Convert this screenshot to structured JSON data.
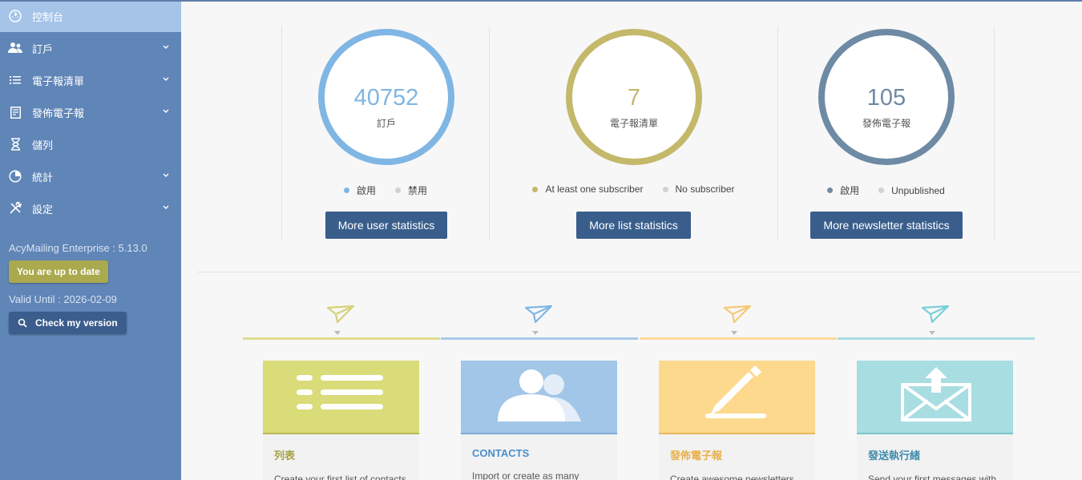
{
  "sidebar": {
    "items": [
      {
        "label": "控制台",
        "icon": "dashboard-icon",
        "active": true
      },
      {
        "label": "訂戶",
        "icon": "users-icon",
        "chevron": true
      },
      {
        "label": "電子報清單",
        "icon": "list-icon",
        "chevron": true
      },
      {
        "label": "發佈電子報",
        "icon": "newsletter-icon",
        "chevron": true
      },
      {
        "label": "儲列",
        "icon": "hourglass-icon"
      },
      {
        "label": "統計",
        "icon": "pie-chart-icon",
        "chevron": true
      },
      {
        "label": "設定",
        "icon": "tools-icon",
        "chevron": true
      }
    ],
    "version": "AcyMailing Enterprise : 5.13.0",
    "uptodate_label": "You are up to date",
    "valid_until": "Valid Until : 2026-02-09",
    "check_version_label": "Check my version"
  },
  "stats": [
    {
      "number": "40752",
      "label": "訂戶",
      "color": "#7fb6e3",
      "legend": [
        {
          "text": "啟用",
          "color": "#7fb6e3"
        },
        {
          "text": "禁用",
          "color": "#d2d2d2"
        }
      ],
      "button": "More user statistics"
    },
    {
      "number": "7",
      "label": "電子報清單",
      "color": "#c4b86a",
      "legend": [
        {
          "text": "At least one subscriber",
          "color": "#c4b86a"
        },
        {
          "text": "No subscriber",
          "color": "#d2d2d2"
        }
      ],
      "button": "More list statistics"
    },
    {
      "number": "105",
      "label": "發佈電子報",
      "color": "#6e8aa4",
      "legend": [
        {
          "text": "啟用",
          "color": "#6e8aa4"
        },
        {
          "text": "Unpublished",
          "color": "#d2d2d2"
        }
      ],
      "button": "More newsletter statistics"
    }
  ],
  "steps": [
    {
      "color": "#dfdc8c",
      "plane_color": "#d8d178"
    },
    {
      "color": "#a8c9e8",
      "plane_color": "#7fb6e3"
    },
    {
      "color": "#fcd99a",
      "plane_color": "#f7c877"
    },
    {
      "color": "#a9dde3",
      "plane_color": "#79cfd9"
    }
  ],
  "cards": [
    {
      "title": "列表",
      "desc": "Create your first list of contacts",
      "color": "#dadb79",
      "title_color": "#a6a144",
      "icon": "list-lines-icon"
    },
    {
      "title": "CONTACTS",
      "desc": "Import or create as many",
      "color": "#a2c6e8",
      "title_color": "#4a8fcb",
      "icon": "contacts-icon"
    },
    {
      "title": "發佈電子報",
      "desc": "Create awesome newsletters",
      "color": "#fdd98e",
      "title_color": "#e8b04a",
      "icon": "pencil-icon"
    },
    {
      "title": "發送執行緒",
      "desc": "Send your first messages with",
      "color": "#a8dde2",
      "title_color": "#3e8cab",
      "icon": "envelope-icon"
    }
  ]
}
